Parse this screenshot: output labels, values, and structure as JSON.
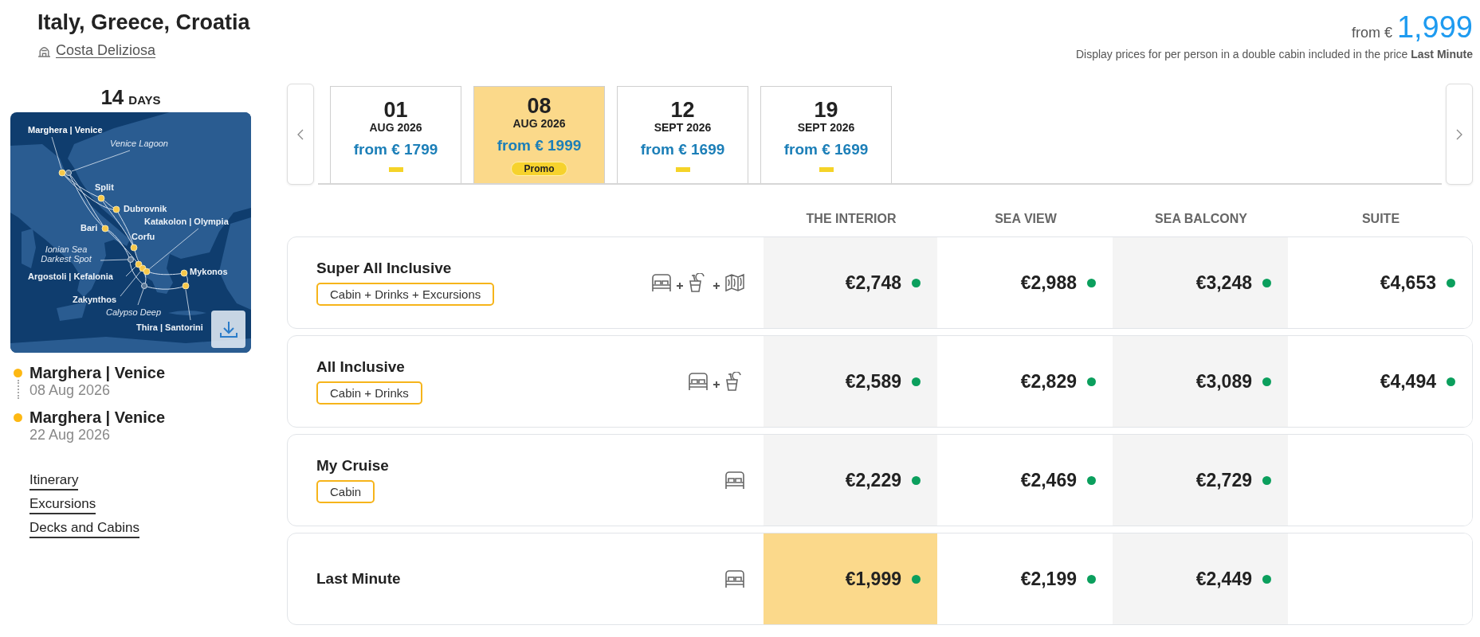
{
  "header": {
    "title": "Italy, Greece, Croatia",
    "ship": "Costa Deliziosa"
  },
  "price_summary": {
    "prefix": "from €",
    "amount": "1,999",
    "note": "Display prices for per person in a double cabin included in the price **Last Minute**"
  },
  "duration": {
    "number": "14",
    "unit": "DAYS"
  },
  "map": {
    "labels": [
      {
        "text": "Marghera | Venice",
        "kind": "embark"
      },
      {
        "text": "Venice Lagoon",
        "kind": "waypoint"
      },
      {
        "text": "Split",
        "kind": "port"
      },
      {
        "text": "Dubrovnik",
        "kind": "port"
      },
      {
        "text": "Bari",
        "kind": "port"
      },
      {
        "text": "Katakolon | Olympia",
        "kind": "port"
      },
      {
        "text": "Corfu",
        "kind": "port"
      },
      {
        "text": "Ionian Sea Darkest Spot",
        "kind": "waypoint"
      },
      {
        "text": "Argostoli | Kefalonia",
        "kind": "port"
      },
      {
        "text": "Mykonos",
        "kind": "port"
      },
      {
        "text": "Zakynthos",
        "kind": "port"
      },
      {
        "text": "Calypso Deep",
        "kind": "waypoint"
      },
      {
        "text": "Thira | Santorini",
        "kind": "port"
      }
    ]
  },
  "itinerary": [
    {
      "port": "Marghera | Venice",
      "date": "08 Aug 2026"
    },
    {
      "port": "Marghera | Venice",
      "date": "22 Aug 2026"
    }
  ],
  "links": [
    "Itinerary",
    "Excursions",
    "Decks and Cabins"
  ],
  "dates": [
    {
      "day": "01",
      "month": "AUG 2026",
      "price": "from € 1799",
      "selected": false
    },
    {
      "day": "08",
      "month": "AUG 2026",
      "price": "from € 1999",
      "selected": true,
      "badge": "Promo"
    },
    {
      "day": "12",
      "month": "SEPT 2026",
      "price": "from € 1699",
      "selected": false
    },
    {
      "day": "19",
      "month": "SEPT 2026",
      "price": "from € 1699",
      "selected": false
    }
  ],
  "table": {
    "columns": [
      "THE INTERIOR",
      "SEA VIEW",
      "SEA BALCONY",
      "SUITE"
    ],
    "rows": [
      {
        "name": "Super All Inclusive",
        "tag": "Cabin + Drinks + Excursions",
        "amenities": [
          {
            "kind": "cabin"
          },
          {
            "kind": "drinks"
          },
          {
            "kind": "excursions"
          }
        ],
        "prices": [
          {
            "value": "€2,748",
            "available": true,
            "selected": false
          },
          {
            "value": "€2,988",
            "available": true,
            "selected": false
          },
          {
            "value": "€3,248",
            "available": true,
            "selected": false
          },
          {
            "value": "€4,653",
            "available": true,
            "selected": false
          }
        ]
      },
      {
        "name": "All Inclusive",
        "tag": "Cabin + Drinks",
        "amenities": [
          {
            "kind": "cabin"
          },
          {
            "kind": "drinks"
          }
        ],
        "prices": [
          {
            "value": "€2,589",
            "available": true,
            "selected": false
          },
          {
            "value": "€2,829",
            "available": true,
            "selected": false
          },
          {
            "value": "€3,089",
            "available": true,
            "selected": false
          },
          {
            "value": "€4,494",
            "available": true,
            "selected": false
          }
        ]
      },
      {
        "name": "My Cruise",
        "tag": "Cabin",
        "amenities": [
          {
            "kind": "cabin"
          }
        ],
        "prices": [
          {
            "value": "€2,229",
            "available": true,
            "selected": false
          },
          {
            "value": "€2,469",
            "available": true,
            "selected": false
          },
          {
            "value": "€2,729",
            "available": true,
            "selected": false
          }
        ]
      },
      {
        "name": "Last Minute",
        "amenities": [
          {
            "kind": "cabin"
          }
        ],
        "prices": [
          {
            "value": "€1,999",
            "available": true,
            "selected": true
          },
          {
            "value": "€2,199",
            "available": true,
            "selected": false
          },
          {
            "value": "€2,449",
            "available": true,
            "selected": false
          }
        ]
      }
    ]
  }
}
